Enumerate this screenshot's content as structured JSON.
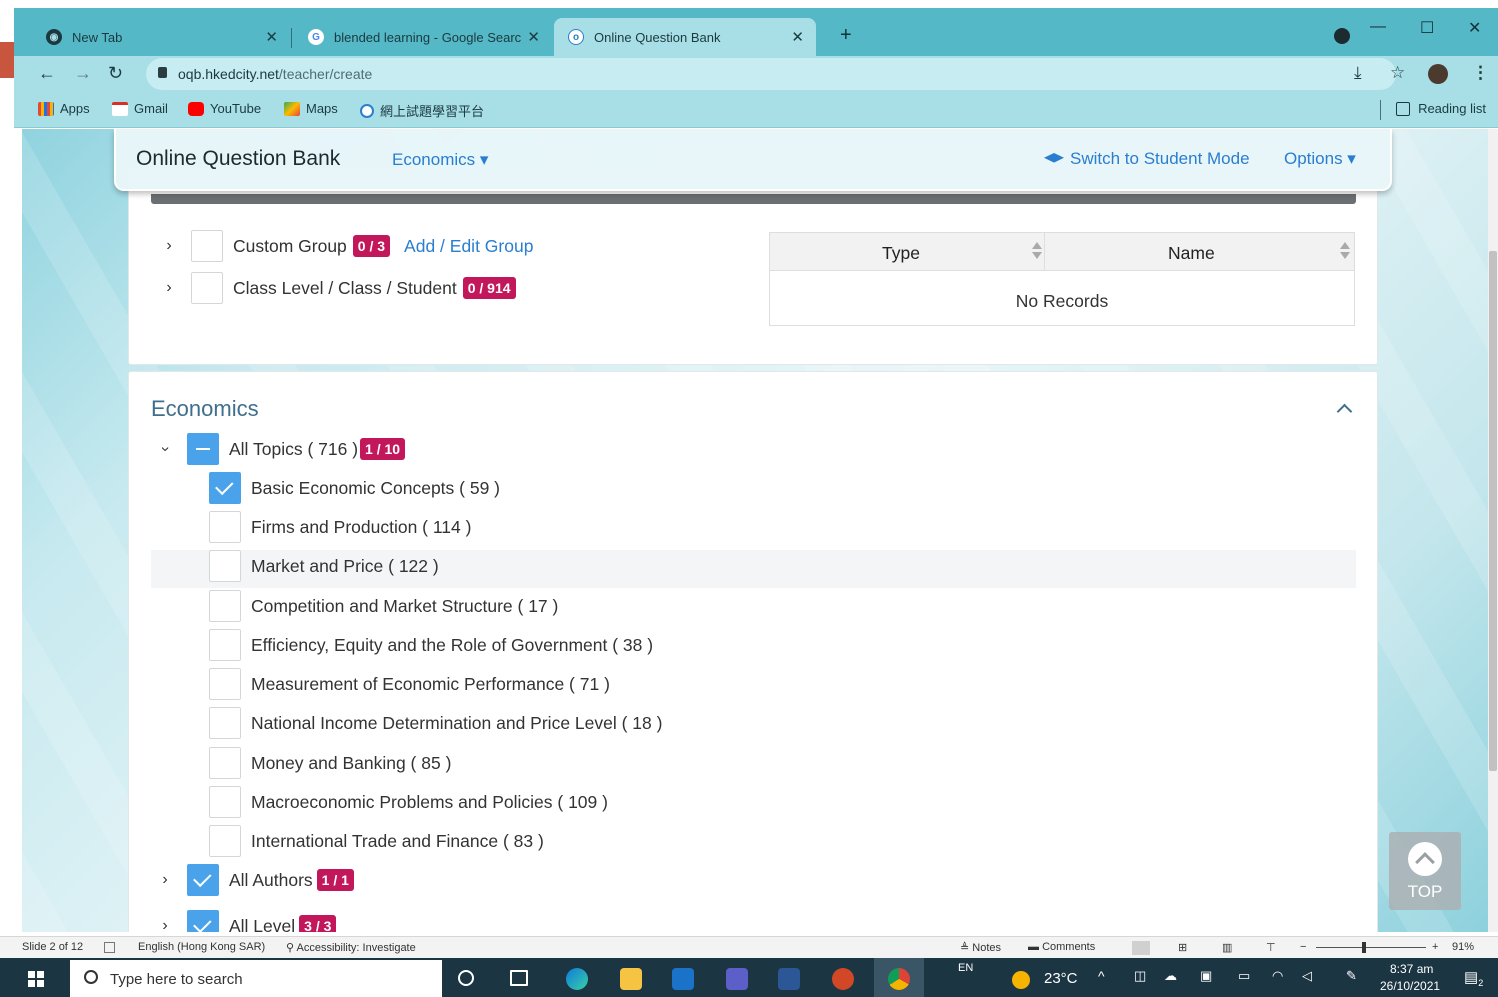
{
  "browser": {
    "tabs": [
      {
        "title": "New Tab",
        "active": false
      },
      {
        "title": "blended learning - Google Searc",
        "active": false
      },
      {
        "title": "Online Question Bank",
        "active": true
      }
    ],
    "url_host": "oqb.hkedcity.net",
    "url_path": "/teacher/create",
    "bookmarks": [
      "Apps",
      "Gmail",
      "YouTube",
      "Maps",
      "網上試題學習平台"
    ],
    "reading_list": "Reading list"
  },
  "header": {
    "brand": "Online Question Bank",
    "subject": "Economics ▾",
    "switch_mode": "Switch to Student Mode",
    "options": "Options ▾"
  },
  "recipients": {
    "custom_group": {
      "label": "Custom Group",
      "badge": "0 / 3",
      "link": "Add / Edit Group"
    },
    "class_level": {
      "label": "Class Level / Class / Student",
      "badge": "0 / 914"
    },
    "table": {
      "col_type": "Type",
      "col_name": "Name",
      "empty": "No Records"
    }
  },
  "economics": {
    "title": "Economics",
    "all_topics": {
      "label": "All Topics ( 716 )",
      "badge": "1 / 10"
    },
    "topics": [
      {
        "label": "Basic Economic Concepts ( 59 )",
        "checked": true
      },
      {
        "label": "Firms and Production ( 114 )",
        "checked": false
      },
      {
        "label": "Market and Price ( 122 )",
        "checked": false
      },
      {
        "label": "Competition and Market Structure ( 17 )",
        "checked": false
      },
      {
        "label": "Efficiency, Equity and the Role of Government ( 38 )",
        "checked": false
      },
      {
        "label": "Measurement of Economic Performance ( 71 )",
        "checked": false
      },
      {
        "label": "National Income Determination and Price Level ( 18 )",
        "checked": false
      },
      {
        "label": "Money and Banking ( 85 )",
        "checked": false
      },
      {
        "label": "Macroeconomic Problems and Policies ( 109 )",
        "checked": false
      },
      {
        "label": "International Trade and Finance ( 83 )",
        "checked": false
      }
    ],
    "all_authors": {
      "label": "All Authors",
      "badge": "1 / 1"
    },
    "all_level": {
      "label": "All Level",
      "badge": "3 / 3"
    }
  },
  "top_button": "TOP",
  "ppt_status": {
    "slide": "Slide 2 of 12",
    "language": "English (Hong Kong SAR)",
    "accessibility": "Accessibility: Investigate",
    "notes": "Notes",
    "comments": "Comments",
    "zoom": "91%"
  },
  "taskbar": {
    "search_placeholder": "Type here to search",
    "lang": "EN",
    "weather": "23°C",
    "time": "8:37 am",
    "date": "26/10/2021",
    "notif_count": "2"
  },
  "colors": {
    "accent": "#2a7ecf",
    "badge": "#c2185b",
    "check": "#4aa3ea",
    "tabstrip": "#55b8c6"
  }
}
